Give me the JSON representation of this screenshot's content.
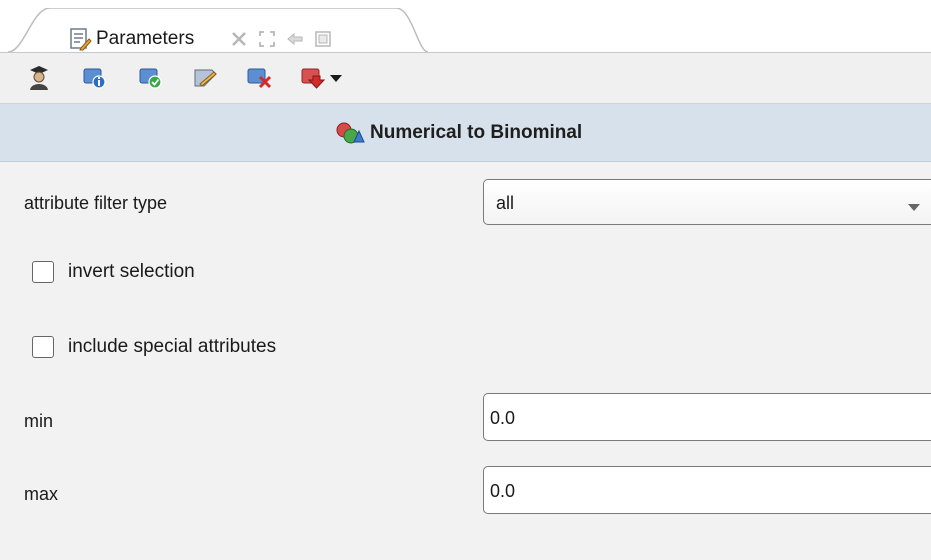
{
  "tab": {
    "title": "Parameters",
    "icons": [
      "parameters-icon",
      "close-icon",
      "maximize-icon",
      "restore-icon",
      "detach-icon"
    ]
  },
  "toolbar": {
    "buttons": [
      {
        "name": "expert-mode-icon"
      },
      {
        "name": "operator-info-icon"
      },
      {
        "name": "enable-operator-icon"
      },
      {
        "name": "rename-operator-icon"
      },
      {
        "name": "delete-operator-icon"
      },
      {
        "name": "breakpoint-icon"
      },
      {
        "name": "dropdown-arrow-icon"
      }
    ]
  },
  "operator": {
    "title": "Numerical to Binominal",
    "icon": "numerical-to-binominal-icon"
  },
  "parameters": {
    "attribute_filter_type": {
      "label": "attribute filter type",
      "value": "all"
    },
    "invert_selection": {
      "label": "invert selection",
      "checked": false
    },
    "include_special_attributes": {
      "label": "include special attributes",
      "checked": false
    },
    "min": {
      "label": "min",
      "value": "0.0"
    },
    "max": {
      "label": "max",
      "value": "0.0"
    }
  },
  "colors": {
    "header_bg": "#d7e1ec",
    "panel_bg": "#f2f2f2",
    "toolbar_bg": "#f0f0f0"
  }
}
